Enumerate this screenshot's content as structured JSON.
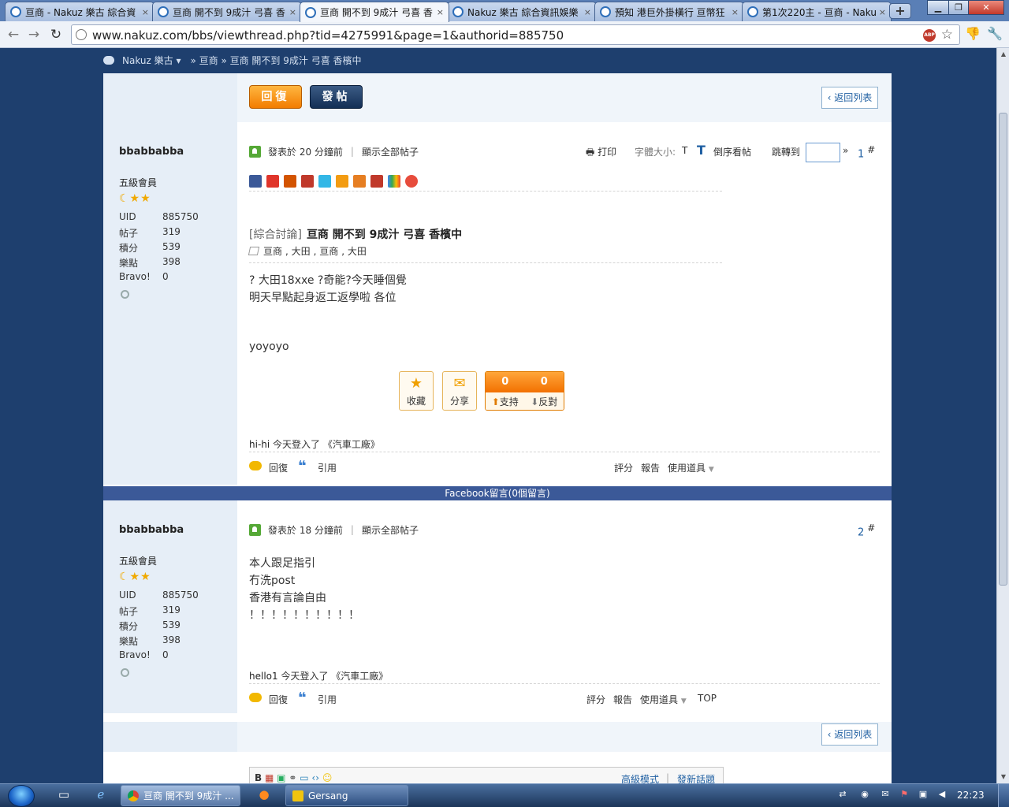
{
  "browser": {
    "tabs": [
      {
        "title": "亘商 - Nakuz 樂古 綜合資"
      },
      {
        "title": "亘商 開不到 9成汁 弓喜 香"
      },
      {
        "title": "亘商 開不到 9成汁 弓喜 香"
      },
      {
        "title": "Nakuz 樂古 綜合資訊娛樂"
      },
      {
        "title": "預知 港巨外掛橫行 亘幣狂"
      },
      {
        "title": "第1次220主 - 亘商 - Naku"
      }
    ],
    "tab_close": "×",
    "new_tab": "+",
    "url": "www.nakuz.com/bbs/viewthread.php?tid=4275991&page=1&authorid=885750",
    "abp_label": "ABP"
  },
  "breadcrumb": {
    "brand": "Nakuz 樂古",
    "path": "» 亘商 » 亘商 開不到 9成汁 弓喜 香檳中"
  },
  "actions": {
    "reply": "回復",
    "post": "發帖",
    "back_to_list": "返回列表"
  },
  "post_tools": {
    "print": "打印",
    "font_size": "字體大小:",
    "font_small": "T",
    "font_big": "T",
    "reverse": "倒序看帖",
    "jump_to": "跳轉到",
    "jump_go": "»"
  },
  "thread": {
    "category": "[綜合討論]",
    "subject": "亘商 開不到 9成汁 弓喜 香檳中",
    "tags": [
      "亘商",
      ", 大田",
      ", 亘商",
      ", 大田"
    ]
  },
  "user_stats_labels": {
    "uid": "UID",
    "posts": "帖子",
    "credits": "積分",
    "points": "樂點",
    "bravo": "Bravo!"
  },
  "posts": [
    {
      "author": "bbabbabba",
      "rank": "五級會員",
      "stars": "☾★★",
      "uid": "885750",
      "posts": "319",
      "credits": "539",
      "points": "398",
      "bravo": "0",
      "posted": "發表於 20 分鐘前",
      "show_all": "顯示全部帖子",
      "floor": "1",
      "body": [
        "? 大田18xxe ?奇能?今天睡個覺",
        "明天早點起身返工返學啦 各位",
        "",
        "yoyoyo"
      ],
      "signature_user": "hi-hi",
      "signature_text": "今天登入了 《汽車工廠》",
      "fav": "收藏",
      "share": "分享",
      "support_count": "0",
      "oppose_count": "0",
      "support": "支持",
      "oppose": "反對",
      "foot_reply": "回復",
      "foot_quote": "引用",
      "rate": "評分",
      "report": "報告",
      "tools": "使用道具"
    },
    {
      "author": "bbabbabba",
      "rank": "五級會員",
      "stars": "☾★★",
      "uid": "885750",
      "posts": "319",
      "credits": "539",
      "points": "398",
      "bravo": "0",
      "posted": "發表於 18 分鐘前",
      "show_all": "顯示全部帖子",
      "floor": "2",
      "body": [
        "本人跟足指引",
        "冇洗post",
        "香港有言論自由",
        "！！！！！！！！！！"
      ],
      "signature_user": "hello1",
      "signature_text": "今天登入了 《汽車工廠》",
      "foot_reply": "回復",
      "foot_quote": "引用",
      "rate": "評分",
      "report": "報告",
      "tools": "使用道具",
      "top": "TOP"
    }
  ],
  "facebook_bar": "Facebook留言(0個留言)",
  "editor": {
    "bold": "B",
    "advanced": "高級模式",
    "new_topic": "發新話題"
  },
  "taskbar": {
    "tasks": [
      {
        "label": "亘商 開不到 9成汁 ..."
      },
      {
        "label": "Gersang"
      }
    ],
    "clock": "22:23"
  },
  "colors": {
    "page_bg": "#1e3f6e",
    "side_bg": "#e6eef7",
    "reply_orange": "#f27d00",
    "post_navy": "#142f55",
    "link_blue": "#1f5fa2",
    "facebook_blue": "#3b5998"
  },
  "icons": {
    "share_icons": [
      "facebook-icon",
      "weibo-icon",
      "plurk-icon",
      "plurk-p-icon",
      "twitter-icon",
      "myspace-icon",
      "kaixin-icon",
      "hd-icon",
      "google-icon",
      "yahoo-icon"
    ]
  }
}
